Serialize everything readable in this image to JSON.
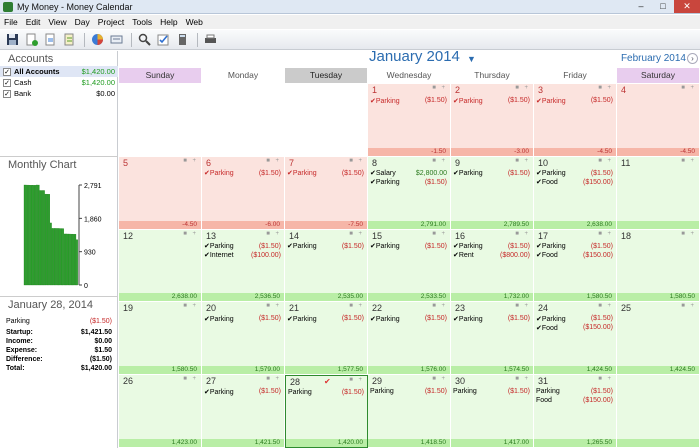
{
  "window": {
    "title": "My Money - Money Calendar",
    "btn_min": "–",
    "btn_max": "□",
    "btn_close": "✕"
  },
  "menu": [
    "File",
    "Edit",
    "View",
    "Day",
    "Project",
    "Tools",
    "Help",
    "Web"
  ],
  "toolbar": {
    "icons": [
      "save-icon",
      "new-icon",
      "import-icon",
      "export-icon",
      "pie-chart-icon",
      "account-icon",
      "search-icon",
      "check-icon",
      "calculator-icon",
      "print-icon"
    ]
  },
  "accounts": {
    "title": "Accounts",
    "items": [
      {
        "name": "All Accounts",
        "amount": "$1,420.00",
        "checked": "✓",
        "selected": true,
        "color": "#1f9b1f"
      },
      {
        "name": "Cash",
        "amount": "$1,420.00",
        "checked": "✓",
        "selected": false,
        "color": "#1f9b1f"
      },
      {
        "name": "Bank",
        "amount": "$0.00",
        "checked": "✓",
        "selected": false,
        "color": "#000000"
      }
    ]
  },
  "monthly_chart": {
    "title": "Monthly Chart",
    "ticks": [
      "2,791",
      "1,860",
      "930",
      "0"
    ]
  },
  "chart_data": {
    "type": "bar",
    "title": "",
    "xlabel": "",
    "ylabel": "",
    "ylim": [
      0,
      2791
    ],
    "categories": [
      "1",
      "2",
      "3",
      "4",
      "5",
      "6",
      "7",
      "8",
      "9",
      "10",
      "11",
      "12",
      "13",
      "14",
      "15",
      "16",
      "17",
      "18",
      "19",
      "20",
      "21",
      "22",
      "23",
      "24",
      "25",
      "26",
      "27",
      "28",
      "29",
      "30",
      "31"
    ],
    "values": [
      2791,
      2789.5,
      2788,
      2786.5,
      2785,
      2783.5,
      2782,
      2791,
      2789.5,
      2638,
      2638,
      2638,
      2536.5,
      2535,
      2533.5,
      1732,
      1580.5,
      1580.5,
      1580.5,
      1579,
      1577.5,
      1576,
      1574.5,
      1424.5,
      1424.5,
      1423,
      1421.5,
      1420,
      1418.5,
      1417,
      1265.5
    ]
  },
  "day_summary": {
    "title": "January 28, 2014",
    "entries": [
      {
        "name": "Parking",
        "amount": "($1.50)"
      }
    ],
    "rows": [
      {
        "label": "Startup:",
        "value": "$1,421.50"
      },
      {
        "label": "Income:",
        "value": "$0.00"
      },
      {
        "label": "Expense:",
        "value": "$1.50"
      },
      {
        "label": "Difference:",
        "value": "($1.50)"
      },
      {
        "label": "Total:",
        "value": "$1,420.00"
      }
    ]
  },
  "calendar": {
    "month_title": "January 2014",
    "next_month": "February 2014",
    "next_arrow": "›",
    "dropdown": "▼",
    "days": [
      "Sunday",
      "Monday",
      "Tuesday",
      "Wednesday",
      "Thursday",
      "Friday",
      "Saturday"
    ],
    "weeks": [
      [
        {
          "day": "",
          "style": "wht",
          "tx": [],
          "bal": ""
        },
        {
          "day": "",
          "style": "wht",
          "tx": [],
          "bal": ""
        },
        {
          "day": "",
          "style": "wht",
          "tx": [],
          "bal": ""
        },
        {
          "day": "1",
          "style": "red",
          "tx": [
            {
              "n": "✔Parking",
              "a": "($1.50)"
            }
          ],
          "bal": "-1.50"
        },
        {
          "day": "2",
          "style": "red",
          "tx": [
            {
              "n": "✔Parking",
              "a": "($1.50)"
            }
          ],
          "bal": "-3.00"
        },
        {
          "day": "3",
          "style": "red",
          "tx": [
            {
              "n": "✔Parking",
              "a": "($1.50)"
            }
          ],
          "bal": "-4.50"
        },
        {
          "day": "4",
          "style": "red",
          "tx": [],
          "bal": "-4.50"
        }
      ],
      [
        {
          "day": "5",
          "style": "red",
          "tx": [],
          "bal": "-4.50"
        },
        {
          "day": "6",
          "style": "red",
          "tx": [
            {
              "n": "✔Parking",
              "a": "($1.50)"
            }
          ],
          "bal": "-6.00"
        },
        {
          "day": "7",
          "style": "red",
          "tx": [
            {
              "n": "✔Parking",
              "a": "($1.50)"
            }
          ],
          "bal": "-7.50"
        },
        {
          "day": "8",
          "style": "grn",
          "tx": [
            {
              "n": "✔Salary",
              "a": "$2,800.00",
              "inc": true
            },
            {
              "n": "✔Parking",
              "a": "($1.50)"
            }
          ],
          "bal": "2,791.00"
        },
        {
          "day": "9",
          "style": "grn",
          "tx": [
            {
              "n": "✔Parking",
              "a": "($1.50)"
            }
          ],
          "bal": "2,789.50"
        },
        {
          "day": "10",
          "style": "grn",
          "tx": [
            {
              "n": "✔Parking",
              "a": "($1.50)"
            },
            {
              "n": "✔Food",
              "a": "($150.00)"
            }
          ],
          "bal": "2,638.00"
        },
        {
          "day": "11",
          "style": "grn",
          "tx": [],
          "bal": ""
        }
      ],
      [
        {
          "day": "12",
          "style": "grn",
          "tx": [],
          "bal": "2,638.00"
        },
        {
          "day": "13",
          "style": "grn",
          "tx": [
            {
              "n": "✔Parking",
              "a": "($1.50)"
            },
            {
              "n": "✔Internet",
              "a": "($100.00)"
            }
          ],
          "bal": "2,536.50"
        },
        {
          "day": "14",
          "style": "grn",
          "tx": [
            {
              "n": "✔Parking",
              "a": "($1.50)"
            }
          ],
          "bal": "2,535.00"
        },
        {
          "day": "15",
          "style": "grn",
          "tx": [
            {
              "n": "✔Parking",
              "a": "($1.50)"
            }
          ],
          "bal": "2,533.50"
        },
        {
          "day": "16",
          "style": "grn",
          "tx": [
            {
              "n": "✔Parking",
              "a": "($1.50)"
            },
            {
              "n": "✔Rent",
              "a": "($800.00)"
            }
          ],
          "bal": "1,732.00"
        },
        {
          "day": "17",
          "style": "grn",
          "tx": [
            {
              "n": "✔Parking",
              "a": "($1.50)"
            },
            {
              "n": "✔Food",
              "a": "($150.00)"
            }
          ],
          "bal": "1,580.50"
        },
        {
          "day": "18",
          "style": "grn",
          "tx": [],
          "bal": "1,580.50"
        }
      ],
      [
        {
          "day": "19",
          "style": "grn",
          "tx": [],
          "bal": "1,580.50"
        },
        {
          "day": "20",
          "style": "grn",
          "tx": [
            {
              "n": "✔Parking",
              "a": "($1.50)"
            }
          ],
          "bal": "1,579.00"
        },
        {
          "day": "21",
          "style": "grn",
          "tx": [
            {
              "n": "✔Parking",
              "a": "($1.50)"
            }
          ],
          "bal": "1,577.50"
        },
        {
          "day": "22",
          "style": "grn",
          "tx": [
            {
              "n": "✔Parking",
              "a": "($1.50)"
            }
          ],
          "bal": "1,576.00"
        },
        {
          "day": "23",
          "style": "grn",
          "tx": [
            {
              "n": "✔Parking",
              "a": "($1.50)"
            }
          ],
          "bal": "1,574.50"
        },
        {
          "day": "24",
          "style": "grn",
          "tx": [
            {
              "n": "✔Parking",
              "a": "($1.50)"
            },
            {
              "n": "✔Food",
              "a": "($150.00)"
            }
          ],
          "bal": "1,424.50"
        },
        {
          "day": "25",
          "style": "grn",
          "tx": [],
          "bal": "1,424.50"
        }
      ],
      [
        {
          "day": "26",
          "style": "grn",
          "tx": [],
          "bal": "1,423.00"
        },
        {
          "day": "27",
          "style": "grn",
          "tx": [
            {
              "n": "✔Parking",
              "a": "($1.50)"
            }
          ],
          "bal": "1,421.50"
        },
        {
          "day": "28",
          "style": "grn",
          "tx": [
            {
              "n": "Parking",
              "a": "($1.50)"
            }
          ],
          "bal": "1,420.00",
          "today": true
        },
        {
          "day": "29",
          "style": "grn",
          "tx": [
            {
              "n": "Parking",
              "a": "($1.50)"
            }
          ],
          "bal": "1,418.50"
        },
        {
          "day": "30",
          "style": "grn",
          "tx": [
            {
              "n": "Parking",
              "a": "($1.50)"
            }
          ],
          "bal": "1,417.00"
        },
        {
          "day": "31",
          "style": "grn",
          "tx": [
            {
              "n": "Parking",
              "a": "($1.50)"
            },
            {
              "n": "Food",
              "a": "($150.00)"
            }
          ],
          "bal": "1,265.50"
        },
        {
          "day": "",
          "style": "grn",
          "tx": [],
          "bal": ""
        }
      ]
    ]
  }
}
